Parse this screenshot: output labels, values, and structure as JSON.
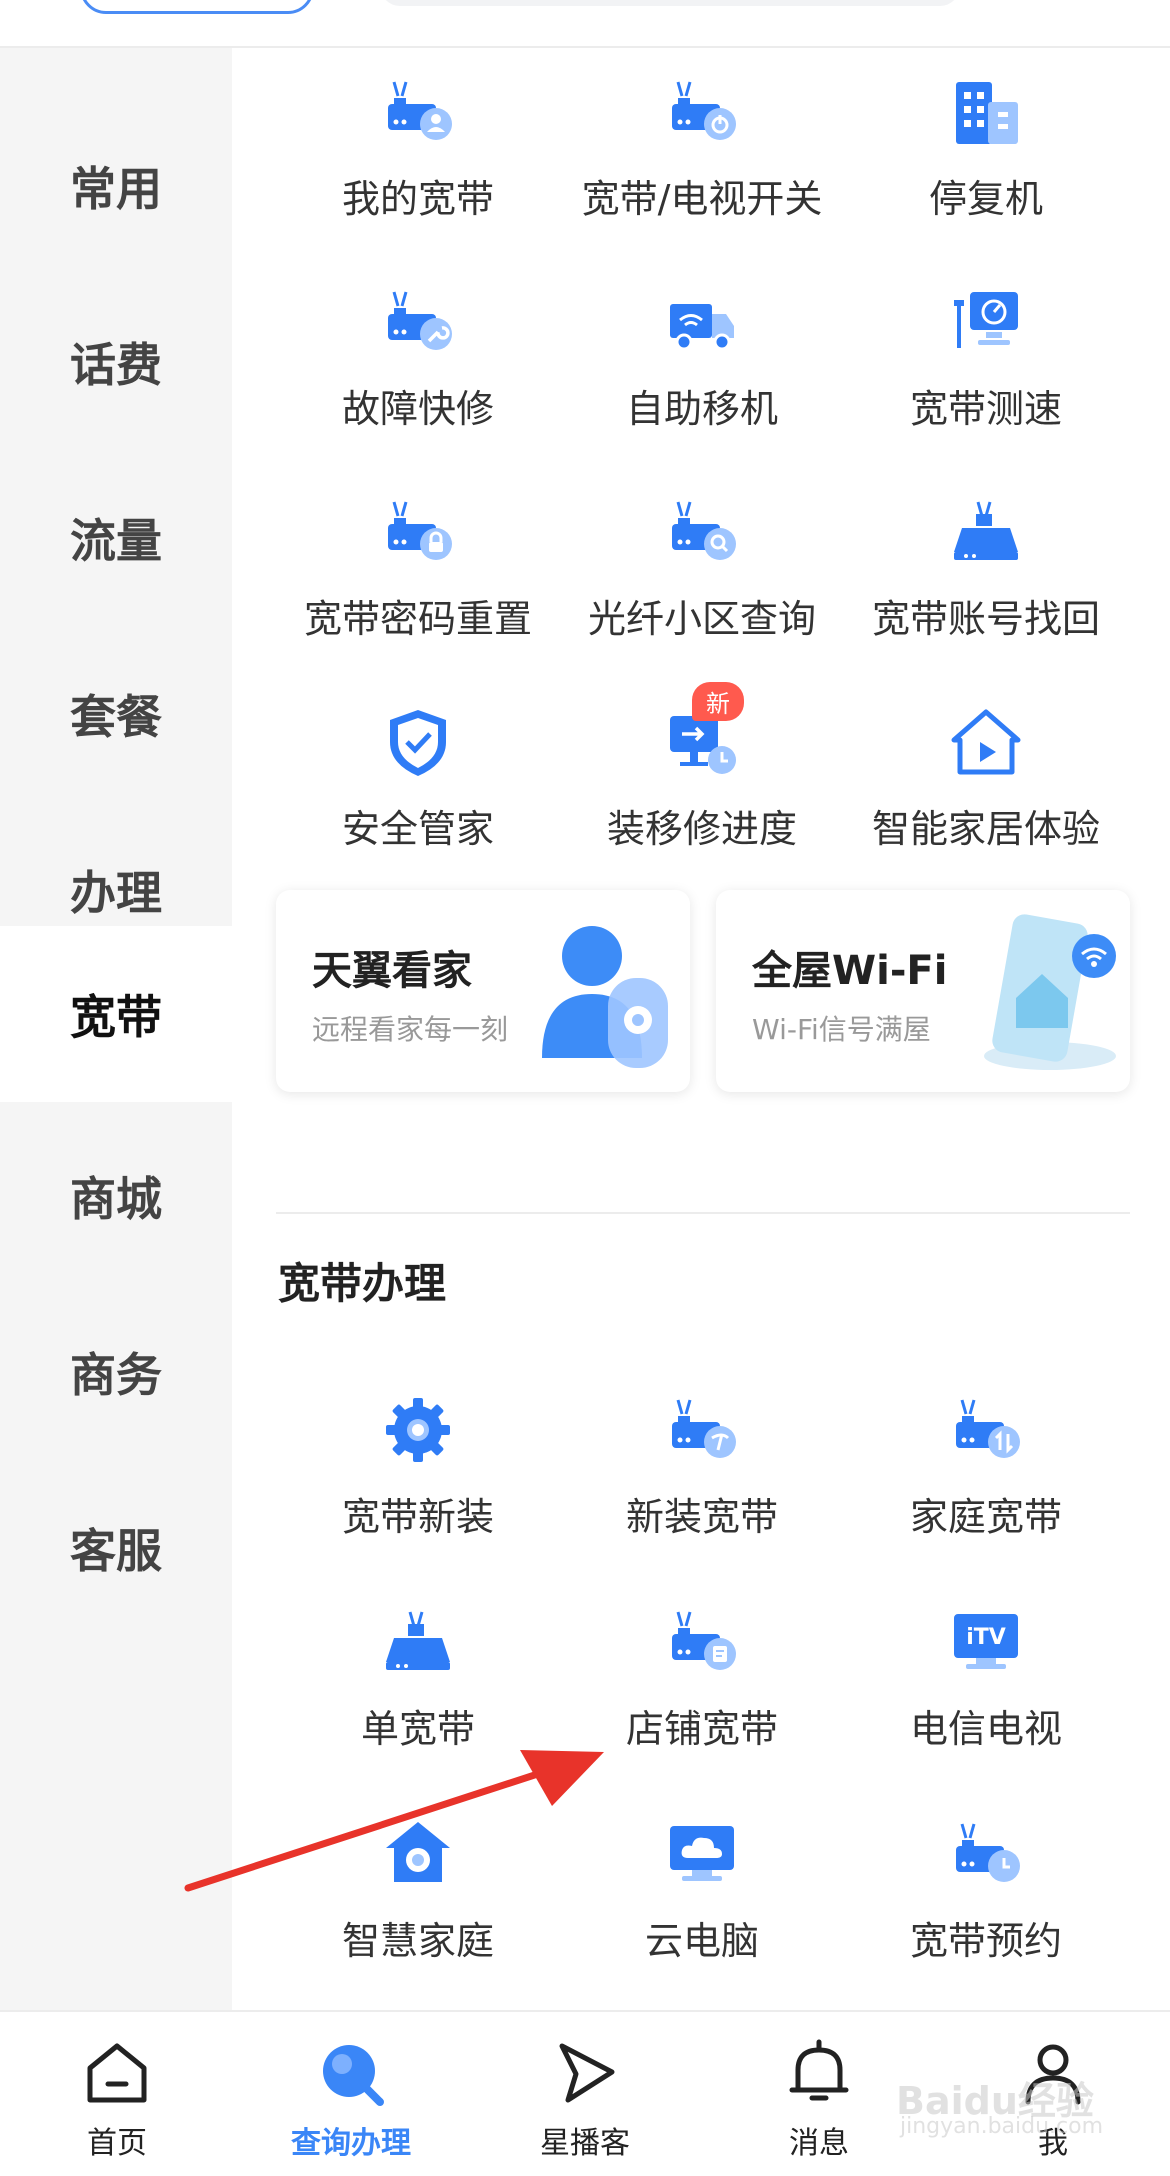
{
  "sidebar": {
    "items": [
      {
        "label": "常用",
        "active": false
      },
      {
        "label": "话费",
        "active": false
      },
      {
        "label": "流量",
        "active": false
      },
      {
        "label": "套餐",
        "active": false
      },
      {
        "label": "办理",
        "active": false
      },
      {
        "label": "宽带",
        "active": true
      },
      {
        "label": "商城",
        "active": false
      },
      {
        "label": "商务",
        "active": false
      },
      {
        "label": "客服",
        "active": false
      }
    ]
  },
  "grid": {
    "items": [
      {
        "label": "我的宽带",
        "icon": "router-user-icon"
      },
      {
        "label": "宽带/电视开关",
        "icon": "router-power-icon"
      },
      {
        "label": "停复机",
        "icon": "building-icon"
      },
      {
        "label": "故障快修",
        "icon": "router-wrench-icon"
      },
      {
        "label": "自助移机",
        "icon": "moving-truck-icon"
      },
      {
        "label": "宽带测速",
        "icon": "speed-test-icon"
      },
      {
        "label": "宽带密码重置",
        "icon": "router-lock-icon"
      },
      {
        "label": "光纤小区查询",
        "icon": "router-search-icon"
      },
      {
        "label": "宽带账号找回",
        "icon": "router-icon"
      },
      {
        "label": "安全管家",
        "icon": "shield-check-icon"
      },
      {
        "label": "装移修进度",
        "icon": "progress-clock-icon",
        "badge": "新"
      },
      {
        "label": "智能家居体验",
        "icon": "smart-home-play-icon"
      }
    ]
  },
  "cards": [
    {
      "title": "天翼看家",
      "subtitle": "远程看家每一刻",
      "icon": "user-camera-icon"
    },
    {
      "title": "全屋Wi-Fi",
      "subtitle": "Wi-Fi信号满屋",
      "icon": "phone-wifi-icon"
    }
  ],
  "section": {
    "title": "宽带办理",
    "items": [
      {
        "label": "宽带新装",
        "icon": "gear-icon"
      },
      {
        "label": "新装宽带",
        "icon": "router-telecom-icon"
      },
      {
        "label": "家庭宽带",
        "icon": "router-updown-icon"
      },
      {
        "label": "单宽带",
        "icon": "router-icon"
      },
      {
        "label": "店铺宽带",
        "icon": "router-doc-icon"
      },
      {
        "label": "电信电视",
        "icon": "itv-icon"
      },
      {
        "label": "智慧家庭",
        "icon": "home-camera-icon"
      },
      {
        "label": "云电脑",
        "icon": "cloud-computer-icon"
      },
      {
        "label": "宽带预约",
        "icon": "router-clock-icon"
      }
    ],
    "itv_text": "iTV"
  },
  "tabbar": {
    "items": [
      {
        "label": "首页",
        "icon": "home-icon",
        "active": false
      },
      {
        "label": "查询办理",
        "icon": "search-icon",
        "active": true
      },
      {
        "label": "星播客",
        "icon": "play-send-icon",
        "active": false
      },
      {
        "label": "消息",
        "icon": "bell-icon",
        "active": false
      },
      {
        "label": "我",
        "icon": "person-icon",
        "active": false
      }
    ]
  },
  "watermark": {
    "line1": "Baidu经验",
    "line2": "jingyan.baidu.com"
  },
  "colors": {
    "primary": "#3a86f7",
    "icon_blue": "#2f7cf6",
    "badge": "#ff5a4e",
    "arrow": "#e8332a"
  }
}
